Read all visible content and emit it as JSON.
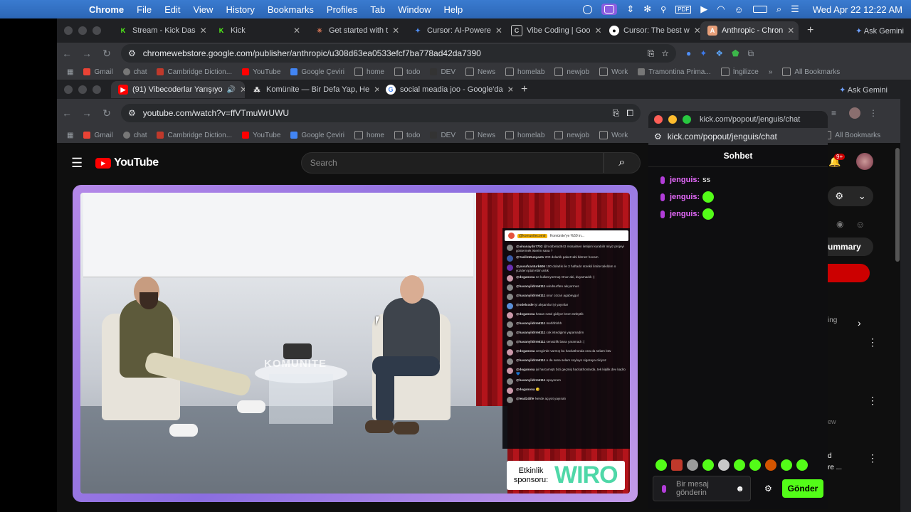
{
  "menubar": {
    "app": "Chrome",
    "items": [
      "File",
      "Edit",
      "View",
      "History",
      "Bookmarks",
      "Profiles",
      "Tab",
      "Window",
      "Help"
    ],
    "clock": "Wed Apr 22  12:22 AM"
  },
  "back_window": {
    "tabs": [
      {
        "label": "Stream - Kick Das",
        "icon": "kick-icon"
      },
      {
        "label": "Kick",
        "icon": "kick-icon"
      },
      {
        "label": "Get started with t",
        "icon": "anthropic-icon"
      },
      {
        "label": "Cursor: AI-Powere",
        "icon": "gemini-icon"
      },
      {
        "label": "Vibe Coding | Goo",
        "icon": "page-icon"
      },
      {
        "label": "Cursor: The best w",
        "icon": "github-icon"
      },
      {
        "label": "Anthropic - Chron",
        "icon": "anthropic-icon"
      }
    ],
    "ask_gemini": "Ask Gemini",
    "url": "chromewebstore.google.com/publisher/anthropic/u308d63ea0533efcf7ba778ad42da7390",
    "bookmarks": [
      "Gmail",
      "chat",
      "Cambridge Diction...",
      "YouTube",
      "Google Çeviri",
      "home",
      "todo",
      "DEV",
      "News",
      "homelab",
      "newjob",
      "Work",
      "Tramontina Prima...",
      "İngilizce"
    ],
    "all_bookmarks": "All Bookmarks"
  },
  "front_window": {
    "tabs": [
      {
        "label": "(91) Vibecoderlar Yarışıyo",
        "icon": "youtube-icon"
      },
      {
        "label": "Komünite — Bir Defa Yap, He",
        "icon": "komunite-icon"
      },
      {
        "label": "social meadia joo - Google'da",
        "icon": "google-icon"
      }
    ],
    "ask_gemini": "Ask Gemini",
    "url": "youtube.com/watch?v=ffVTmuWrUWU",
    "bookmarks": [
      "Gmail",
      "chat",
      "Cambridge Diction...",
      "YouTube",
      "Google Çeviri",
      "home",
      "todo",
      "DEV",
      "News",
      "homelab",
      "newjob",
      "Work"
    ],
    "all_bookmarks": "All Bookmarks"
  },
  "youtube": {
    "logo": "YouTube",
    "search_placeholder": "Search",
    "notification_count": "9+",
    "side_label_summary": "ummary",
    "side_label_ing": "ing",
    "side_label_ew": "ew",
    "side_label_d": "d",
    "side_label_re": "re ..."
  },
  "video": {
    "sponsor_label": "Etkinlik sponsoru:",
    "sponsor_logo": "WIRO",
    "table_text": "KOMÜNITE",
    "overlay_header_user": "@komunitecomtr",
    "overlay_header_text": "Komünite'ye %50 in...",
    "overlay_messages": [
      {
        "user": "@ainanaydn7702",
        "text": "@rootbeta3943 müsaitsen iletişim kurabilir miyiz projeyi göstermek isterim sana ?"
      },
      {
        "user": "@YazilmDunyastv",
        "text": "200 dolarlık paket tabi bitmez hocam"
      },
      {
        "user": "@yusufcanturk606",
        "text": "100 dolarlık ile 3 haftadır sürekli limite takıldım o yüzden iptal ettim artık"
      },
      {
        "user": "@doganona",
        "text": "ne kullanıyormuş Onur abi, duyamadık :)"
      },
      {
        "user": "@hasanyildrm6111",
        "text": "windsurften akıyormus"
      },
      {
        "user": "@hasanyildrm6111",
        "text": "onur ozcan agabeygul"
      },
      {
        "user": "@odelcode",
        "text": "iyi akşamlar iyi yayınlar"
      },
      {
        "user": "@doganona",
        "text": "hasan nasıl gidiyor brom özleptik"
      },
      {
        "user": "@hasanyildrm6111",
        "text": "mehhhhhh"
      },
      {
        "user": "@hasanyildrm6111",
        "text": "cok istedigimi yapamadim"
      },
      {
        "user": "@hasanyildrm6111",
        "text": "senaizlik bana yaramadı :("
      },
      {
        "user": "@doganona",
        "text": "cengiz'de varmış bu hackathonda ona da selam btw"
      },
      {
        "user": "@hasanyildrm6111",
        "text": "o da sana selam soyluyo sigaraya cikiyoz"
      },
      {
        "user": "@doganona",
        "text": "iyi harcamıştı bizi geçmiş hackathonlarda, tek kişilik dev kadro 💙"
      },
      {
        "user": "@hasanyildrm6111",
        "text": "opuyorum"
      },
      {
        "user": "@doganona",
        "text": "😏"
      },
      {
        "user": "@lead24life",
        "text": "Nerde açıyot yayınalı"
      }
    ]
  },
  "kick": {
    "url_title": "kick.com/popout/jenguis/chat",
    "url": "kick.com/popout/jenguis/chat",
    "header": "Sohbet",
    "messages": [
      {
        "user": "jenguis:",
        "text": "ss",
        "emote": false
      },
      {
        "user": "jenguis:",
        "text": "",
        "emote": true
      },
      {
        "user": "jenguis:",
        "text": "",
        "emote": true
      }
    ],
    "input_placeholder": "Bir mesaj gönderin",
    "send_button": "Gönder",
    "accent": "#53fc18"
  }
}
